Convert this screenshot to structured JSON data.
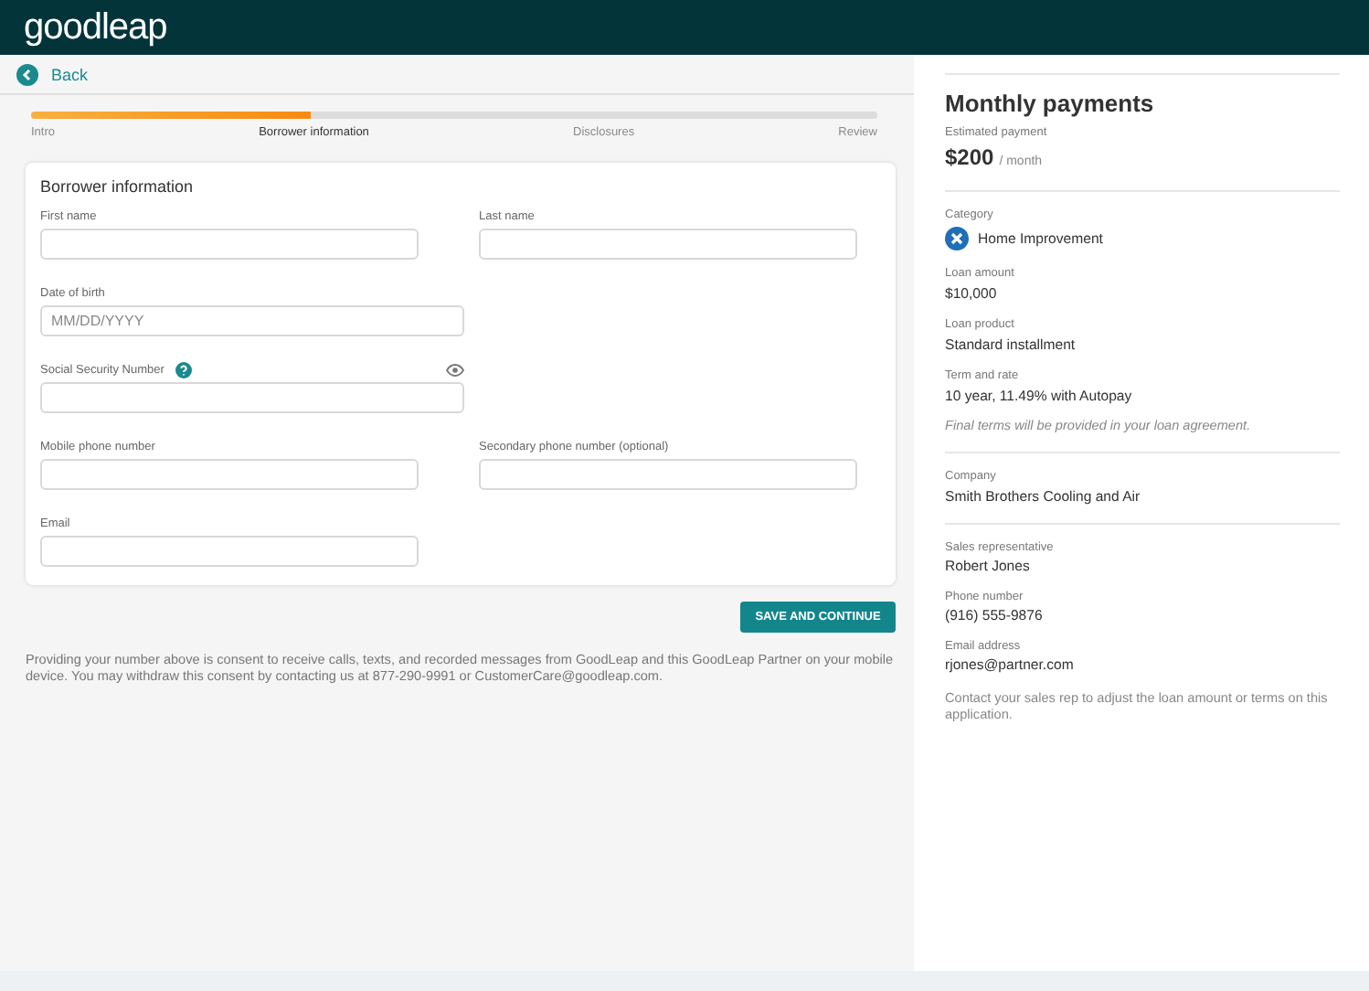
{
  "header": {
    "logo": "goodleap"
  },
  "back": {
    "label": "Back"
  },
  "progress": {
    "level": 0.33,
    "steps": [
      {
        "label": "Intro",
        "selected": false
      },
      {
        "label": "Borrower information",
        "selected": true
      },
      {
        "label": "Disclosures",
        "selected": false
      },
      {
        "label": "Review",
        "selected": false
      }
    ]
  },
  "form": {
    "title": "Borrower information",
    "rows": [
      [
        {
          "label": "First name",
          "kind": "text"
        },
        {
          "label": "Last name",
          "kind": "text"
        }
      ],
      [
        {
          "label": "Date of birth",
          "kind": "date",
          "placeholder": "MM/DD/YYYY"
        }
      ],
      [
        {
          "label": "Social Security Number",
          "kind": "secure"
        }
      ],
      [
        {
          "label": "Mobile phone number",
          "kind": "text"
        },
        {
          "label": "Secondary phone number (optional)",
          "kind": "text"
        }
      ],
      [
        {
          "label": "Email",
          "kind": "text"
        }
      ]
    ]
  },
  "submit": {
    "label": "SAVE AND CONTINUE"
  },
  "consent": "Providing your number above is consent to receive calls, texts, and recorded messages from GoodLeap and this GoodLeap Partner on your mobile device. You may withdraw this consent by contacting us at 877-290-9991 or CustomerCare@goodleap.com.",
  "summary": {
    "title": "Monthly payments",
    "estimate_label": "Estimated payment",
    "amount": "$200",
    "period": "/ month",
    "sections": [
      [
        {
          "label": "Category",
          "value": "Home Improvement",
          "kind": "category"
        },
        {
          "label": "Loan amount",
          "value": "$10,000",
          "kind": "plain"
        },
        {
          "label": "Loan product",
          "value": "Standard installment",
          "kind": "plain"
        },
        {
          "label": "Term and rate",
          "value": "10 year, 11.49% with Autopay",
          "kind": "plain",
          "note": "Final terms will be provided in your loan agreement."
        }
      ],
      [
        {
          "label": "Company",
          "value": "Smith Brothers Cooling and Air",
          "kind": "plain"
        }
      ],
      [
        {
          "label": "Sales representative",
          "value": "Robert Jones",
          "kind": "tight"
        },
        {
          "label": "Phone number",
          "value": "(916) 555-9876",
          "kind": "tight"
        },
        {
          "label": "Email address",
          "value": "rjones@partner.com",
          "kind": "tight"
        }
      ]
    ],
    "footnote": "Contact your sales rep to adjust the loan amount or terms on this application."
  }
}
